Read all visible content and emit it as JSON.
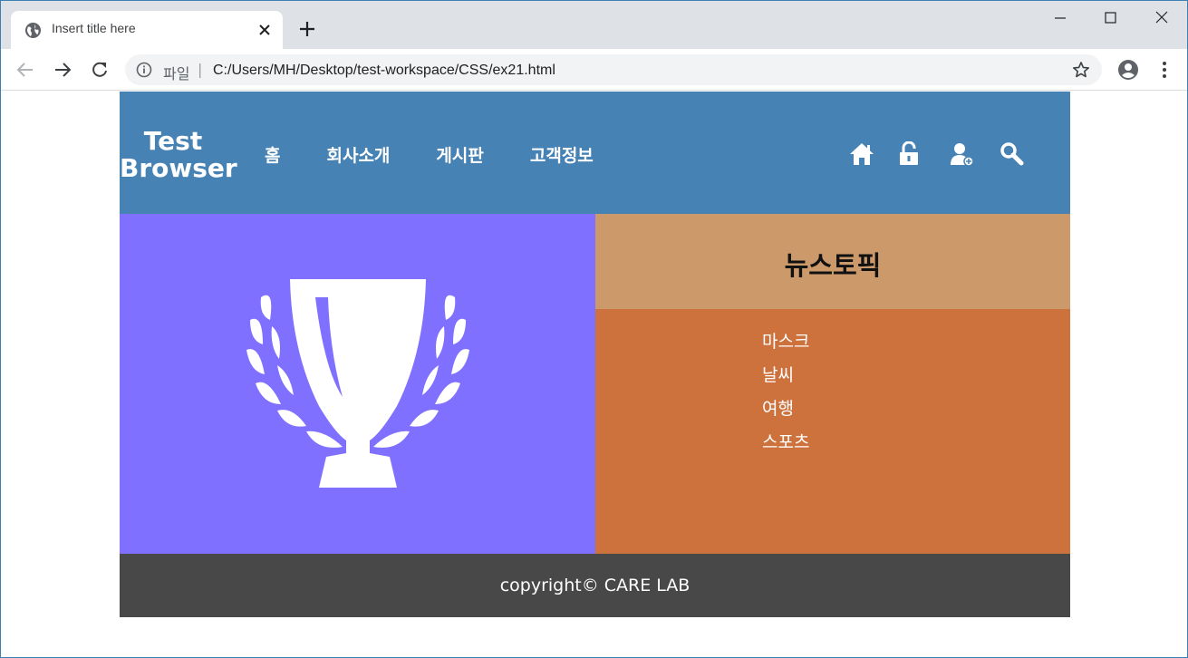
{
  "browser": {
    "tab_title": "Insert title here",
    "omnibox_scheme": "파일",
    "omnibox_separator": "|",
    "url": "C:/Users/MH/Desktop/test-workspace/CSS/ex21.html"
  },
  "header": {
    "logo": "Test Browser",
    "nav": [
      "홈",
      "회사소개",
      "게시판",
      "고객정보"
    ],
    "icons": [
      "home-icon",
      "lock-icon",
      "add-user-icon",
      "search-icon"
    ]
  },
  "hero": {
    "image": "trophy-laurel-icon"
  },
  "news": {
    "title": "뉴스토픽",
    "items": [
      "마스크",
      "날씨",
      "여행",
      "스포츠"
    ]
  },
  "footer": {
    "copyright": "copyright© CARE LAB"
  },
  "colors": {
    "header_bg": "#4682b4",
    "hero_bg": "#8070ff",
    "news_head_bg": "#cc996a",
    "news_body_bg": "#cd723d",
    "footer_bg": "#484848"
  }
}
